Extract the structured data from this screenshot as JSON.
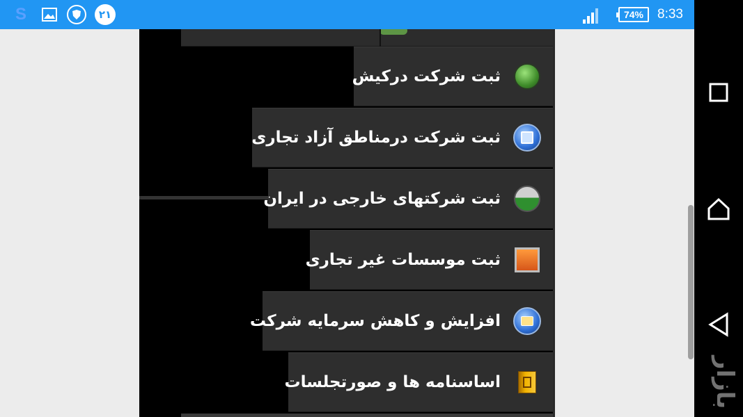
{
  "status_bar": {
    "battery": "74%",
    "time": "8:33",
    "notification_number": "۲۱",
    "icons": [
      "s-app-icon",
      "gallery-icon",
      "shield-icon",
      "number-badge-icon",
      "signal-icon",
      "battery-icon"
    ]
  },
  "menu": {
    "items": [
      {
        "label": "ثبت شرکت درکیش",
        "icon": "green-circle-icon"
      },
      {
        "label": "ثبت شرکت درمناطق آزاد تجاری",
        "icon": "blue-document-icon"
      },
      {
        "label": "ثبت شرکتهای خارجی در ایران",
        "icon": "dome-icon"
      },
      {
        "label": "ثبت موسسات غیر تجاری",
        "icon": "orange-square-icon"
      },
      {
        "label": "افزایش و کاهش سرمایه شرکت",
        "icon": "blue-folder-icon"
      },
      {
        "label": "اساسنامه ها و صورتجلسات",
        "icon": "archive-book-icon"
      }
    ]
  },
  "nav_bar": {
    "buttons": [
      "recent-apps",
      "home",
      "back"
    ],
    "watermark": "بازار"
  },
  "colors": {
    "status_bar": "#2196f3",
    "panel": "#000000",
    "item": "#2e2e2e",
    "text": "#ffffff"
  }
}
